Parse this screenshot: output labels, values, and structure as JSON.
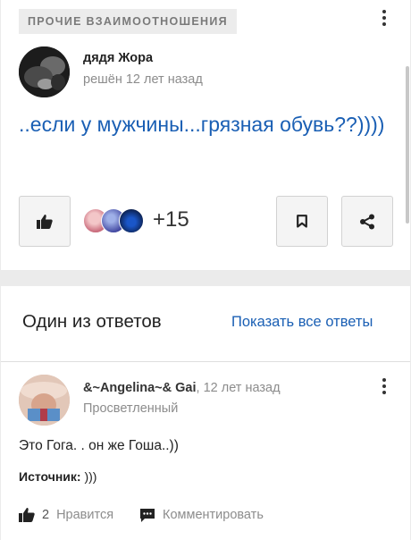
{
  "question": {
    "category": "ПРОЧИЕ ВЗАИМООТНОШЕНИЯ",
    "author": "дядя Жора",
    "status": "решён 12 лет назад",
    "title": "..если у мужчины...грязная обувь??))))",
    "likes_extra": "+15"
  },
  "answers_section": {
    "title": "Один из ответов",
    "show_all_label": "Показать все ответы"
  },
  "answer": {
    "author": "&~Angelina~& Gai",
    "time": ", 12 лет назад",
    "rank": "Просветленный",
    "text": "Это Гога. . он же Гоша..))",
    "source_label": "Источник:",
    "source_value": " )))",
    "like_count": "2",
    "like_label": "Нравится",
    "comment_label": "Комментировать"
  },
  "icons": {
    "like": "thumbs-up-icon",
    "bookmark": "bookmark-icon",
    "share": "share-icon",
    "menu": "more-vertical-icon",
    "comment": "comment-icon"
  },
  "colors": {
    "link": "#1a5fb4",
    "muted": "#8c8c8c",
    "background": "#ebebeb"
  }
}
